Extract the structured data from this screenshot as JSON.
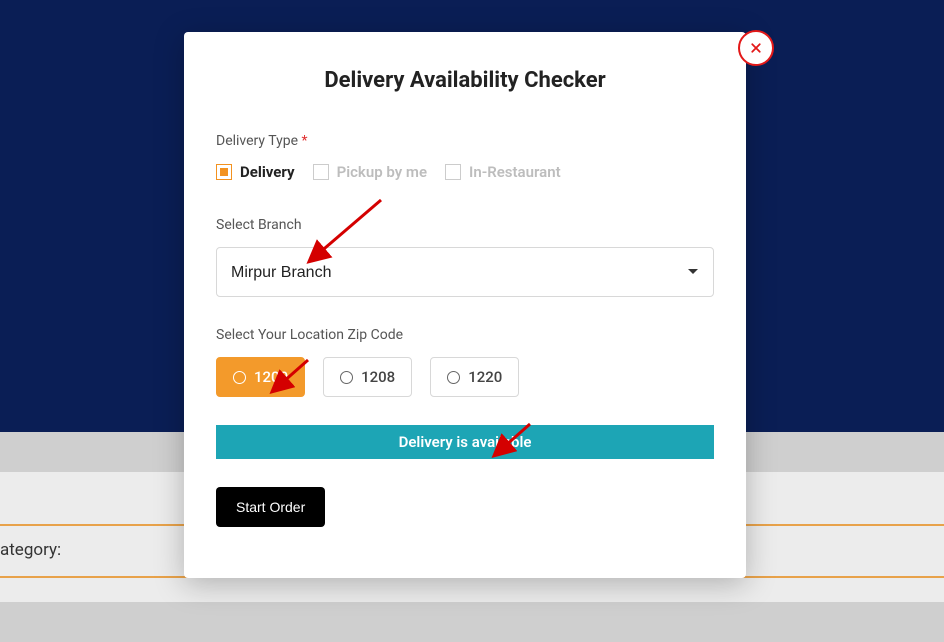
{
  "background": {
    "category_label": "ategory:"
  },
  "modal": {
    "title": "Delivery Availability Checker",
    "delivery_type": {
      "label": "Delivery Type",
      "options": {
        "delivery": "Delivery",
        "pickup": "Pickup by me",
        "in_restaurant": "In-Restaurant"
      },
      "selected": "delivery"
    },
    "branch": {
      "label": "Select Branch",
      "selected": "Mirpur Branch"
    },
    "zip": {
      "label": "Select Your Location Zip Code",
      "options": [
        "1200",
        "1208",
        "1220"
      ],
      "selected": "1200"
    },
    "availability_message": "Delivery is available",
    "start_button": "Start Order"
  },
  "colors": {
    "navy": "#0a1e55",
    "accent": "#f39a2b",
    "teal": "#1da5b5",
    "close_red": "#e31818"
  }
}
